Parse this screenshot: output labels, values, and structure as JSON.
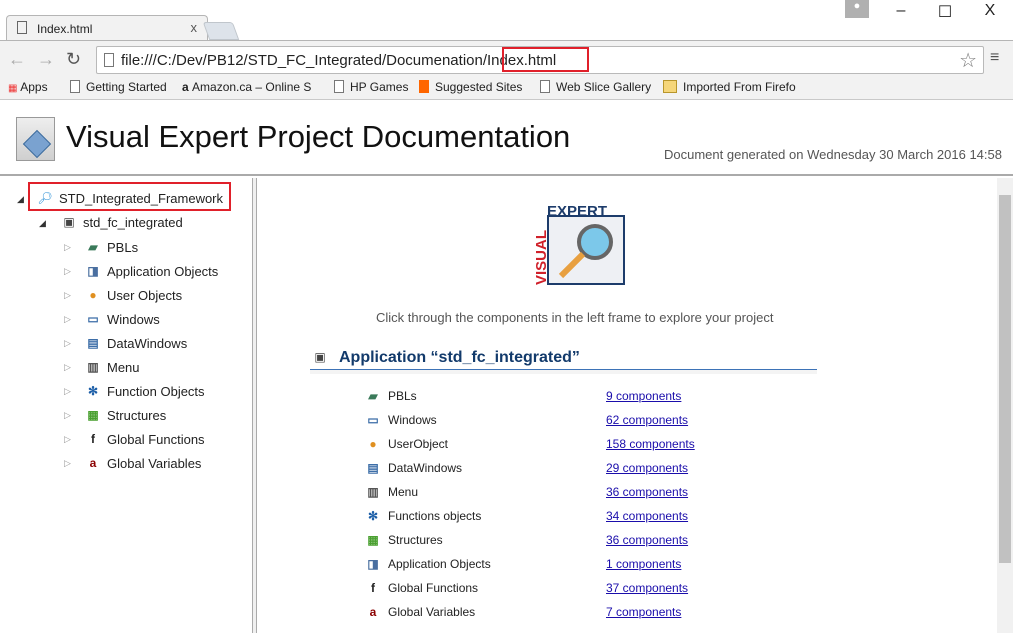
{
  "browser": {
    "tab_title": "Index.html",
    "tab_close": "x",
    "url": "file:///C:/Dev/PB12/STD_FC_Integrated/Documenation/Index.html",
    "window_controls": {
      "minimize": "–",
      "maximize": "☐",
      "close": "X"
    },
    "bookmarks": [
      "Apps",
      "Getting Started",
      "Amazon.ca – Online S",
      "HP Games",
      "Suggested Sites",
      "Web Slice Gallery",
      "Imported From Firefo"
    ]
  },
  "header": {
    "title": "Visual Expert Project Documentation",
    "generated": "Document generated on Wednesday 30 March 2016 14:58"
  },
  "tree": {
    "root": "STD_Integrated_Framework",
    "app": "std_fc_integrated",
    "items": [
      {
        "label": "PBLs",
        "icon": "pbl-icon"
      },
      {
        "label": "Application Objects",
        "icon": "application-object-icon"
      },
      {
        "label": "User Objects",
        "icon": "user-object-icon"
      },
      {
        "label": "Windows",
        "icon": "window-icon"
      },
      {
        "label": "DataWindows",
        "icon": "datawindow-icon"
      },
      {
        "label": "Menu",
        "icon": "menu-icon"
      },
      {
        "label": "Function Objects",
        "icon": "function-object-icon"
      },
      {
        "label": "Structures",
        "icon": "structure-icon"
      },
      {
        "label": "Global Functions",
        "icon": "global-function-icon"
      },
      {
        "label": "Global Variables",
        "icon": "global-variable-icon"
      }
    ]
  },
  "main": {
    "logo_text": {
      "top": "EXPERT",
      "side": "VISUAL"
    },
    "intro": "Click through the components in the left frame to explore your project",
    "app_title": "Application “std_fc_integrated”",
    "rows": [
      {
        "label": "PBLs",
        "link": "9 components",
        "icon": "pbl-icon"
      },
      {
        "label": "Windows",
        "link": "62 components",
        "icon": "window-icon"
      },
      {
        "label": "UserObject",
        "link": "158 components",
        "icon": "user-object-icon"
      },
      {
        "label": "DataWindows",
        "link": "29 components",
        "icon": "datawindow-icon"
      },
      {
        "label": "Menu",
        "link": "36 components",
        "icon": "menu-icon"
      },
      {
        "label": "Functions objects",
        "link": "34 components",
        "icon": "function-object-icon"
      },
      {
        "label": "Structures",
        "link": "36 components",
        "icon": "structure-icon"
      },
      {
        "label": "Application Objects",
        "link": "1 components",
        "icon": "application-object-icon"
      },
      {
        "label": "Global Functions",
        "link": "37 components",
        "icon": "global-function-icon"
      },
      {
        "label": "Global Variables",
        "link": "7 components",
        "icon": "global-variable-icon"
      }
    ]
  },
  "colors": {
    "highlight": "#e0202a",
    "link": "#1a0dab",
    "heading": "#123a6b"
  }
}
